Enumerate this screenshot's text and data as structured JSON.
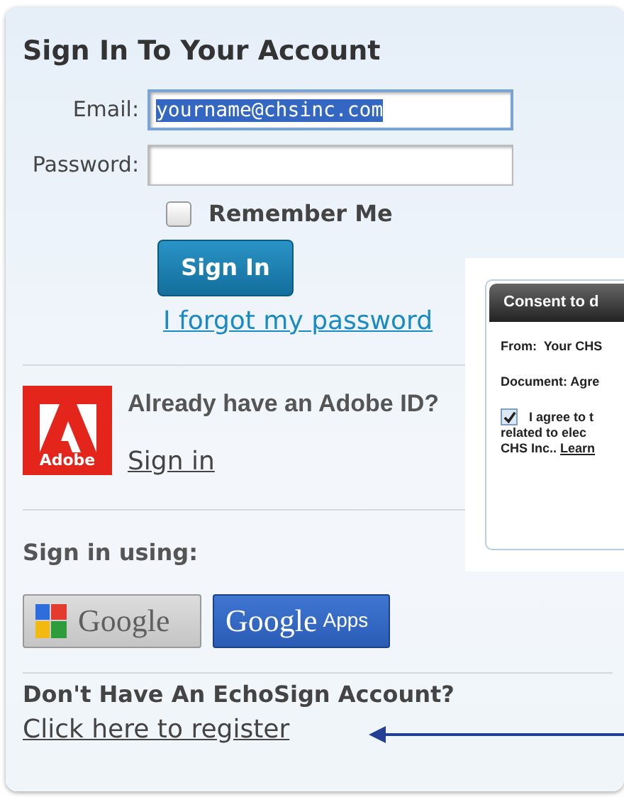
{
  "title": "Sign In To Your Account",
  "fields": [
    {
      "label": "Email:",
      "value": "yourname@chsinc.com",
      "text_selected": true,
      "focused": true
    },
    {
      "label": "Password:",
      "focused": false
    }
  ],
  "remember_me": {
    "label": "Remember Me",
    "checked": false
  },
  "sign_in_button": "Sign In",
  "forgot_link": "I forgot my password",
  "adobe": {
    "logo_text": "Adobe",
    "heading": "Already have an Adobe ID?",
    "link": "Sign in"
  },
  "social": {
    "heading": "Sign in using:",
    "buttons": [
      {
        "label": "Google",
        "kind": "google"
      },
      {
        "label": "Google",
        "suffix": "Apps",
        "kind": "google_apps"
      }
    ]
  },
  "register": {
    "heading": "Don't Have An EchoSign Account?",
    "link": "Click here to register"
  },
  "consent_dialog": {
    "title": "Consent to d",
    "from_label": "From:",
    "from_value": "Your CHS",
    "document_label": "Document:",
    "document_value": "Agre",
    "agree": {
      "checked": true,
      "lines": [
        "I agree to t",
        "related to elec",
        "CHS Inc.."
      ],
      "link": "Learn"
    }
  }
}
